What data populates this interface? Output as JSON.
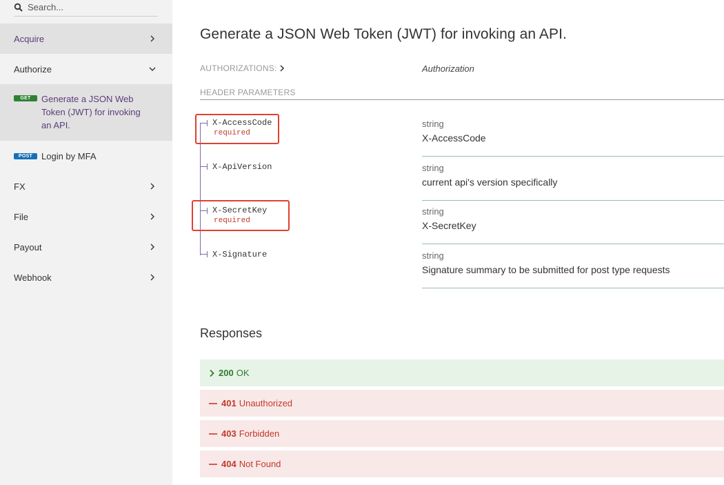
{
  "search": {
    "placeholder": "Search..."
  },
  "sidebar": {
    "items": [
      {
        "label": "Acquire"
      },
      {
        "label": "Authorize"
      },
      {
        "label": "FX"
      },
      {
        "label": "File"
      },
      {
        "label": "Payout"
      },
      {
        "label": "Webhook"
      }
    ],
    "sub_items": [
      {
        "method": "GET",
        "label": "Generate a JSON Web Token (JWT) for invoking an API."
      },
      {
        "method": "POST",
        "label": "Login by MFA"
      }
    ]
  },
  "main": {
    "title": "Generate a JSON Web Token (JWT) for invoking an API.",
    "authorizations_label": "AUTHORIZATIONS:",
    "authorizations_value": "Authorization",
    "header_parameters_label": "HEADER PARAMETERS",
    "params": [
      {
        "name": "X-AccessCode",
        "required": "required",
        "type": "string",
        "description": "X-AccessCode"
      },
      {
        "name": "X-ApiVersion",
        "required": "",
        "type": "string",
        "description": "current api's version specifically"
      },
      {
        "name": "X-SecretKey",
        "required": "required",
        "type": "string",
        "description": "X-SecretKey"
      },
      {
        "name": "X-Signature",
        "required": "",
        "type": "string",
        "description": "Signature summary to be submitted for post type requests"
      }
    ],
    "responses_title": "Responses",
    "responses": [
      {
        "code": "200",
        "text": "OK"
      },
      {
        "code": "401",
        "text": "Unauthorized"
      },
      {
        "code": "403",
        "text": "Forbidden"
      },
      {
        "code": "404",
        "text": "Not Found"
      }
    ]
  },
  "colors": {
    "accent": "#5a3e7a",
    "get": "#2f8132",
    "post": "#186fb9",
    "error": "#c0392b",
    "success": "#2f7a2f",
    "highlight": "#e04030"
  }
}
